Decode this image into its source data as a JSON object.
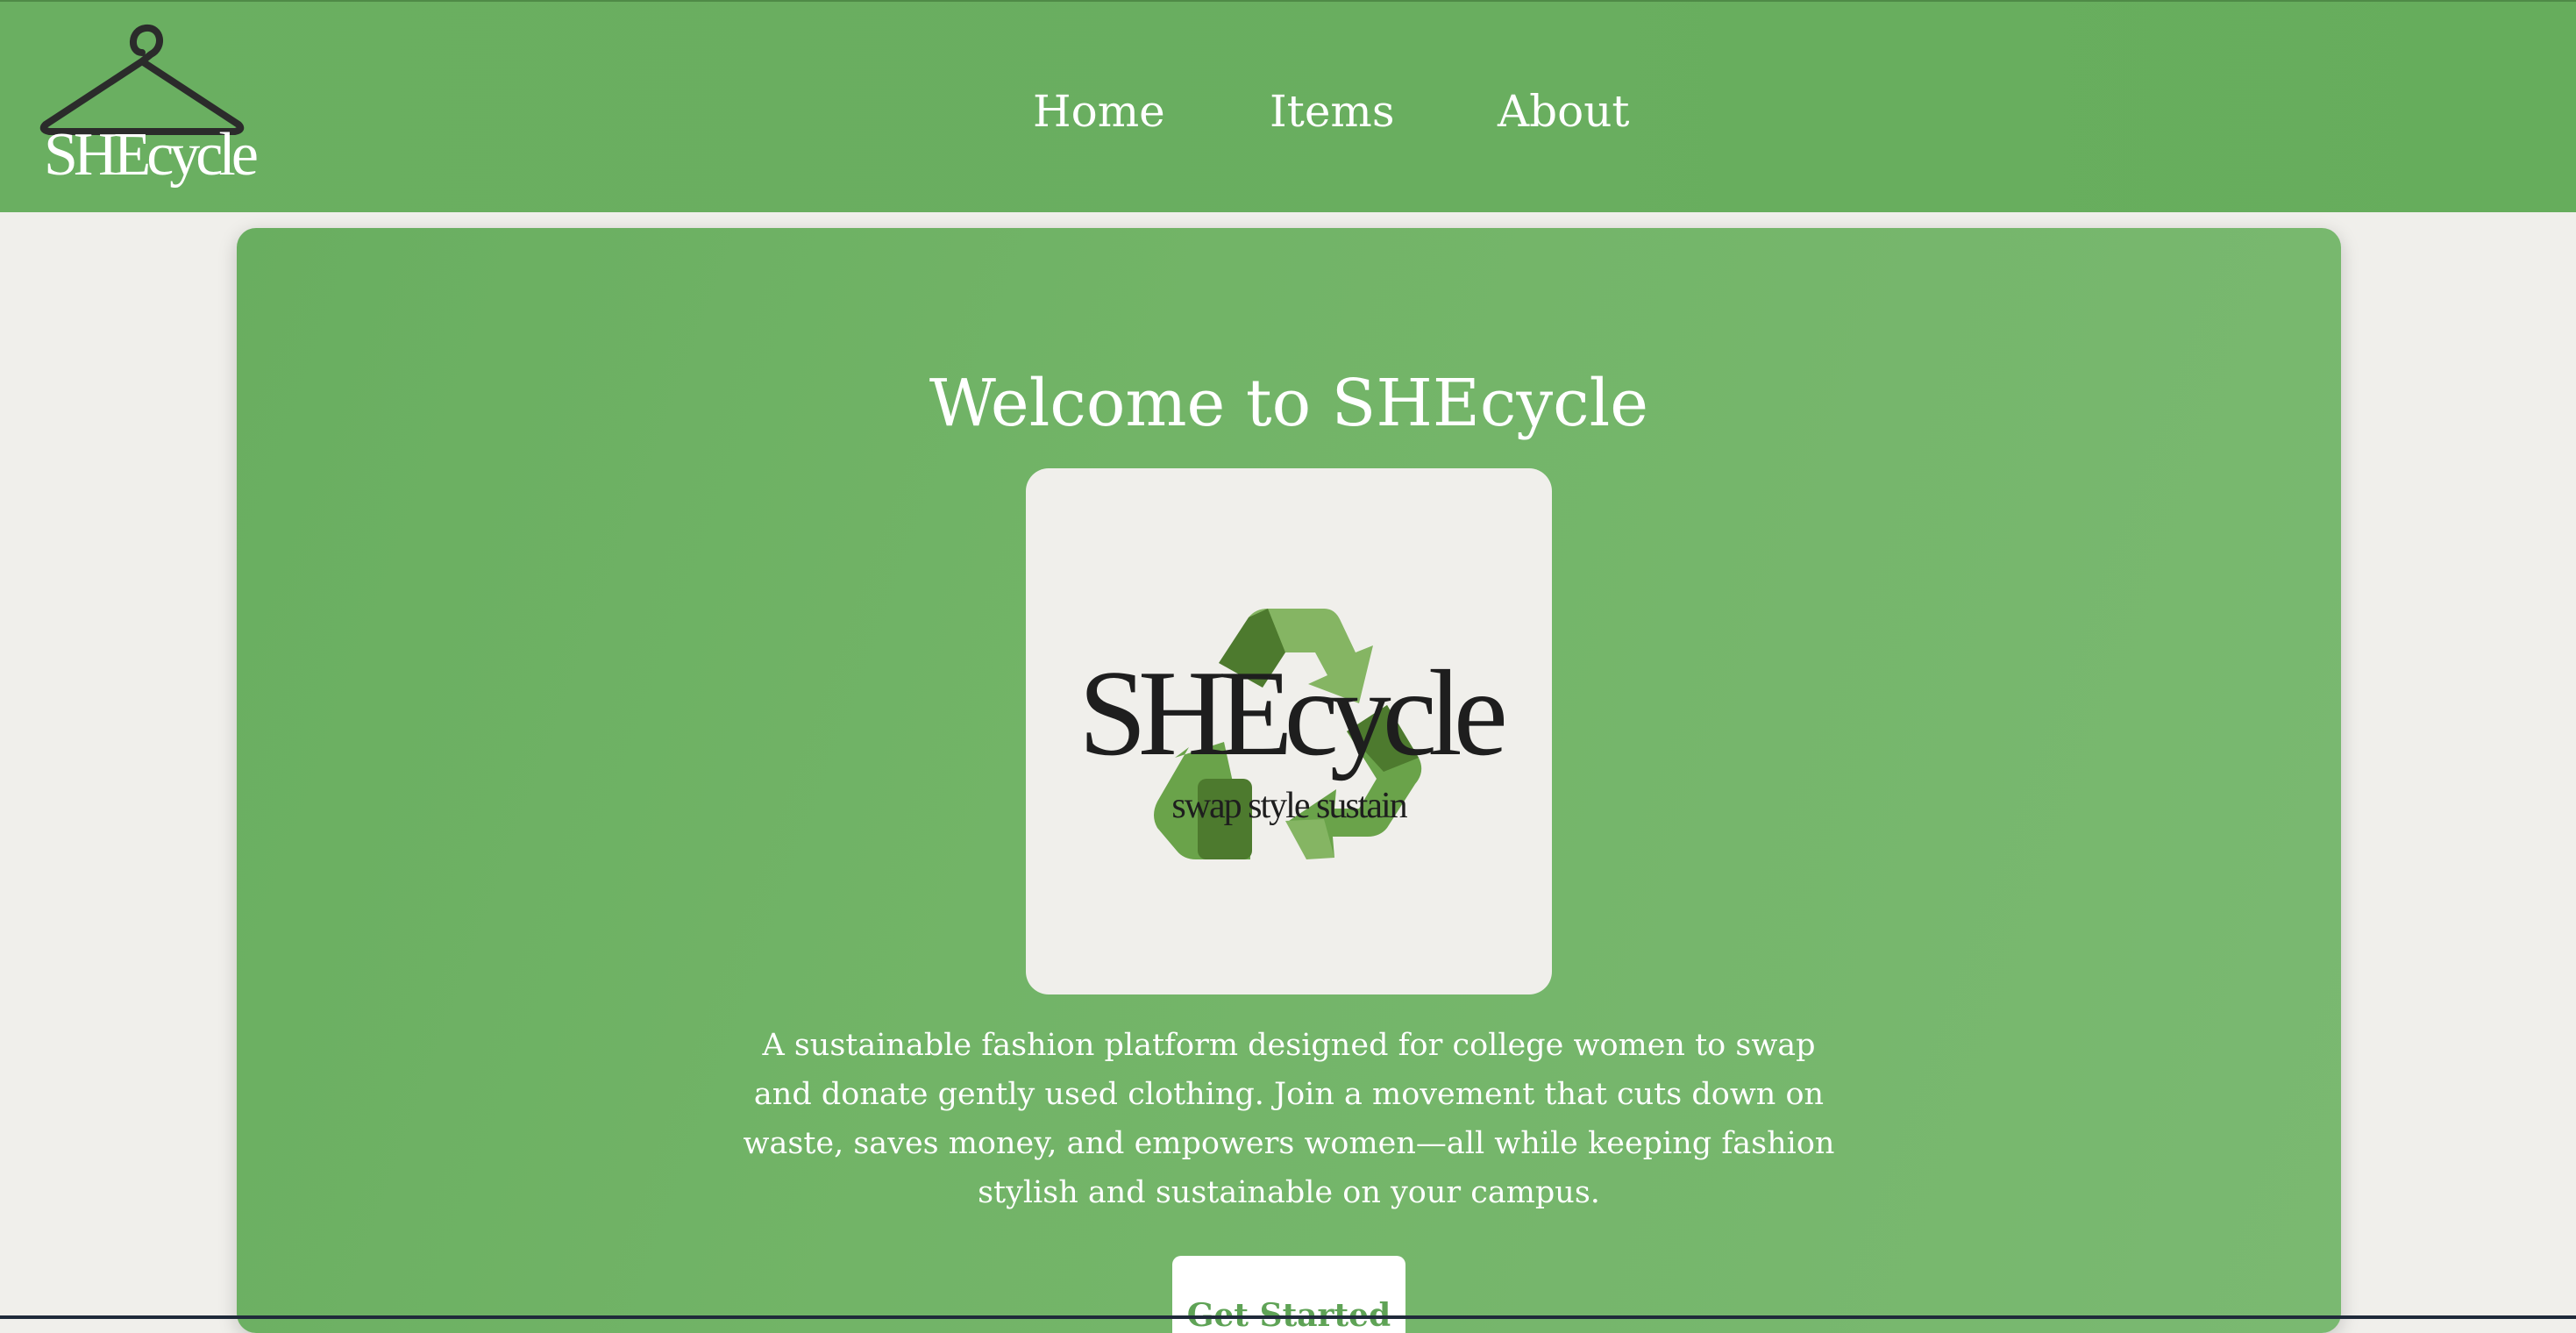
{
  "brand": {
    "name": "SHEcycle",
    "logo_icon": "hanger-icon"
  },
  "nav": {
    "items": [
      {
        "label": "Home"
      },
      {
        "label": "Items"
      },
      {
        "label": "About"
      }
    ]
  },
  "hero": {
    "title": "Welcome to SHEcycle",
    "logo_brand": "SHEcycle",
    "logo_tagline": "swap style sustain",
    "logo_icon": "recycle-icon",
    "description": "A sustainable fashion platform designed for college women to swap and donate gently used clothing. Join a movement that cuts down on waste, saves money, and empowers women—all while keeping fashion stylish and sustainable on your campus.",
    "cta_label": "Get Started"
  },
  "colors": {
    "primary_green": "#69ae60",
    "background": "#f0efeb",
    "text_light": "#ffffff",
    "text_dark": "#1e1e1e",
    "button_text": "#5fa356",
    "recycle_light": "#85b563",
    "recycle_mid": "#6aa34a",
    "recycle_dark": "#4d7a2e"
  }
}
